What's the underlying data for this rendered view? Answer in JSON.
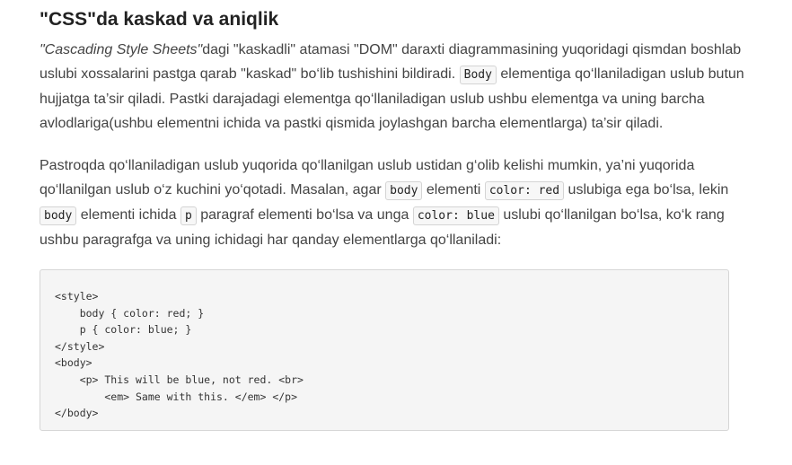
{
  "heading": "\"CSS\"da kaskad va aniqlik",
  "paragraph1": {
    "em": "\"Cascading Style Sheets\"",
    "text1": "dagi \"kaskadli\" atamasi \"DOM\" daraxti diagrammasining yuqoridagi qismdan boshlab uslubi xossalarini pastga qarab \"kaskad\" bo‘lib tushishini bildiradi. ",
    "code1": "Body",
    "text2": " elementiga qo‘llaniladigan uslub butun hujjatga ta’sir qiladi. Pastki darajadagi elementga qo‘llaniladigan uslub ushbu elementga va uning barcha avlodlariga(ushbu elementni ichida va pastki qismida joylashgan barcha elementlarga) ta’sir qiladi."
  },
  "paragraph2": {
    "text1": "Pastroqda qo‘llaniladigan uslub yuqorida qo‘llanilgan uslub ustidan g‘olib kelishi mumkin, ya’ni yuqorida qo‘llanilgan uslub o‘z kuchini yo‘qotadi. Masalan, agar ",
    "code1": "body",
    "text2": " elementi ",
    "code2": "color: red",
    "text3": " uslubiga ega bo‘lsa, lekin ",
    "code3": "body",
    "text4": " elementi ichida ",
    "code4": "p",
    "text5": " paragraf elementi bo‘lsa va unga ",
    "code5": "color: blue",
    "text6": " uslubi qo‘llanilgan bo‘lsa, ko‘k rang ushbu paragrafga va uning ichidagi har qanday elementlarga qo‘llaniladi:"
  },
  "code_lines": [
    "<style>",
    "    body { color: red; }",
    "    p { color: blue; }",
    "</style>",
    "<body>",
    "    <p> This will be blue, not red. <br>",
    "        <em> Same with this. </em> </p>",
    "</body>"
  ]
}
